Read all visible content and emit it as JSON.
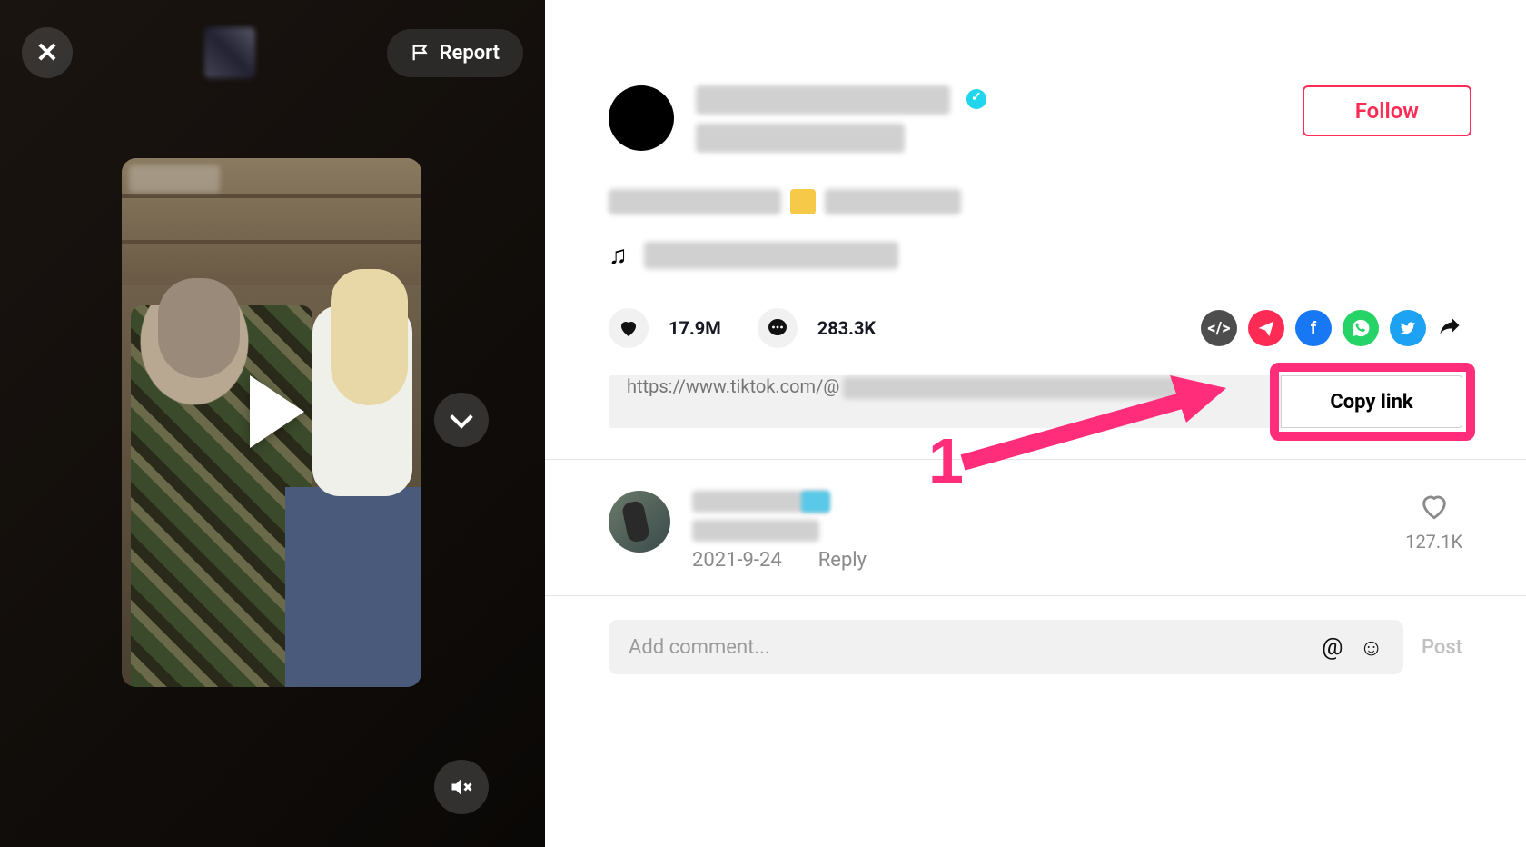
{
  "video_pane": {
    "report_label": "Report"
  },
  "header": {
    "follow_label": "Follow"
  },
  "stats": {
    "likes": "17.9M",
    "comments": "283.3K"
  },
  "link": {
    "url_prefix": "https://www.tiktok.com/@",
    "copy_label": "Copy link"
  },
  "annotation": {
    "step": "1"
  },
  "comment": {
    "date": "2021-9-24",
    "reply_label": "Reply",
    "likes": "127.1K"
  },
  "compose": {
    "placeholder": "Add comment...",
    "post_label": "Post"
  }
}
